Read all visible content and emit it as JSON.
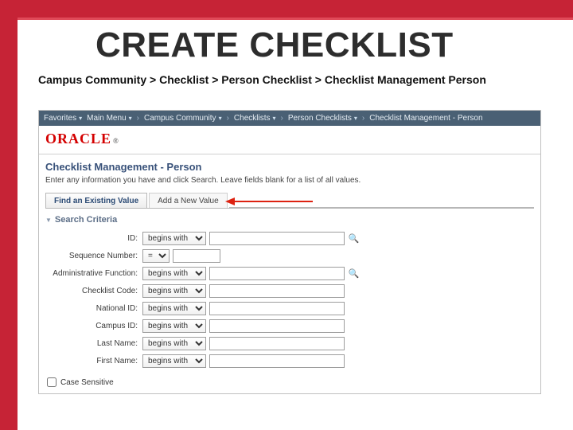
{
  "slide": {
    "title": "CREATE CHECKLIST",
    "nav_path": "Campus Community > Checklist > Person Checklist > Checklist Management Person"
  },
  "crumbs": {
    "favorites": "Favorites",
    "main_menu": "Main Menu",
    "c1": "Campus Community",
    "c2": "Checklists",
    "c3": "Person Checklists",
    "c4": "Checklist Management - Person"
  },
  "logo": {
    "text": "ORACLE",
    "reg": "®"
  },
  "page": {
    "heading": "Checklist Management - Person",
    "sub": "Enter any information you have and click Search. Leave fields blank for a list of all values."
  },
  "tabs": {
    "find": "Find an Existing Value",
    "add": "Add a New Value"
  },
  "search_heading": "Search Criteria",
  "fields": {
    "id": {
      "label": "ID:",
      "op": "begins with"
    },
    "seq": {
      "label": "Sequence Number:",
      "op": "="
    },
    "admin_func": {
      "label": "Administrative Function:",
      "op": "begins with"
    },
    "checklist_code": {
      "label": "Checklist Code:",
      "op": "begins with"
    },
    "national_id": {
      "label": "National ID:",
      "op": "begins with"
    },
    "campus_id": {
      "label": "Campus ID:",
      "op": "begins with"
    },
    "last_name": {
      "label": "Last Name:",
      "op": "begins with"
    },
    "first_name": {
      "label": "First Name:",
      "op": "begins with"
    }
  },
  "case_sensitive": "Case Sensitive"
}
